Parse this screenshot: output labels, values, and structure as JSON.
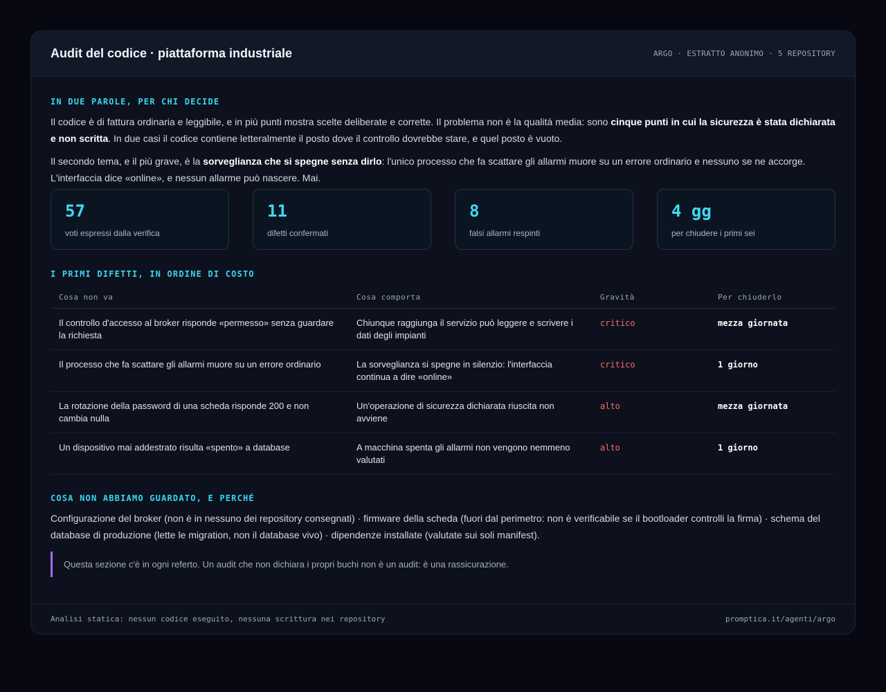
{
  "header": {
    "title": "Audit del codice · piattaforma industriale",
    "meta": "ARGO · ESTRATTO ANONIMO · 5 REPOSITORY"
  },
  "summary": {
    "label": "IN DUE PAROLE, PER CHI DECIDE",
    "p1_a": "Il codice è di fattura ordinaria e leggibile, e in più punti mostra scelte deliberate e corrette. Il problema non è la qualità media: sono ",
    "p1_bold": "cinque punti in cui la sicurezza è stata dichiarata e non scritta",
    "p1_b": ". In due casi il codice contiene letteralmente il posto dove il controllo dovrebbe stare, e quel posto è vuoto.",
    "p2_a": "Il secondo tema, e il più grave, è la ",
    "p2_bold": "sorveglianza che si spegne senza dirlo",
    "p2_b": ": l'unico processo che fa scattare gli allarmi muore su un errore ordinario e nessuno se ne accorge. L'interfaccia dice «online», e nessun allarme può nascere. Mai."
  },
  "stats": [
    {
      "value": "57",
      "label": "voti espressi dalla verifica"
    },
    {
      "value": "11",
      "label": "difetti confermati"
    },
    {
      "value": "8",
      "label": "falsi allarmi respinti"
    },
    {
      "value": "4 gg",
      "label": "per chiudere i primi sei"
    }
  ],
  "defects": {
    "label": "I PRIMI DIFETTI, IN ORDINE DI COSTO",
    "columns": [
      "Cosa non va",
      "Cosa comporta",
      "Gravità",
      "Per chiuderlo"
    ],
    "rows": [
      [
        "Il controllo d'accesso al broker risponde «permesso» senza guardare la richiesta",
        "Chiunque raggiunga il servizio può leggere e scrivere i dati degli impianti",
        "critico",
        "mezza giornata"
      ],
      [
        "Il processo che fa scattare gli allarmi muore su un errore ordinario",
        "La sorveglianza si spegne in silenzio: l'interfaccia continua a dire «online»",
        "critico",
        "1 giorno"
      ],
      [
        "La rotazione della password di una scheda risponde 200 e non cambia nulla",
        "Un'operazione di sicurezza dichiarata riuscita non avviene",
        "alto",
        "mezza giornata"
      ],
      [
        "Un dispositivo mai addestrato risulta «spento» a database",
        "A macchina spenta gli allarmi non vengono nemmeno valutati",
        "alto",
        "1 giorno"
      ]
    ]
  },
  "scope": {
    "label": "COSA NON ABBIAMO GUARDATO, E PERCHÉ",
    "text": "Configurazione del broker (non è in nessuno dei repository consegnati) · firmware della scheda (fuori dal perimetro: non è verificabile se il bootloader controlli la firma) · schema del database di produzione (lette le migration, non il database vivo) · dipendenze installate (valutate sui soli manifest).",
    "note": "Questa sezione c'è in ogni referto. Un audit che non dichiara i propri buchi non è un audit: è una rassicurazione."
  },
  "footer": {
    "left": "Analisi statica: nessun codice eseguito, nessuna scrittura nei repository",
    "right": "promptica.it/agenti/argo"
  },
  "colors": {
    "accent": "#38d6ee",
    "severity": "#f26b6b",
    "note_border": "#a66cf0"
  }
}
